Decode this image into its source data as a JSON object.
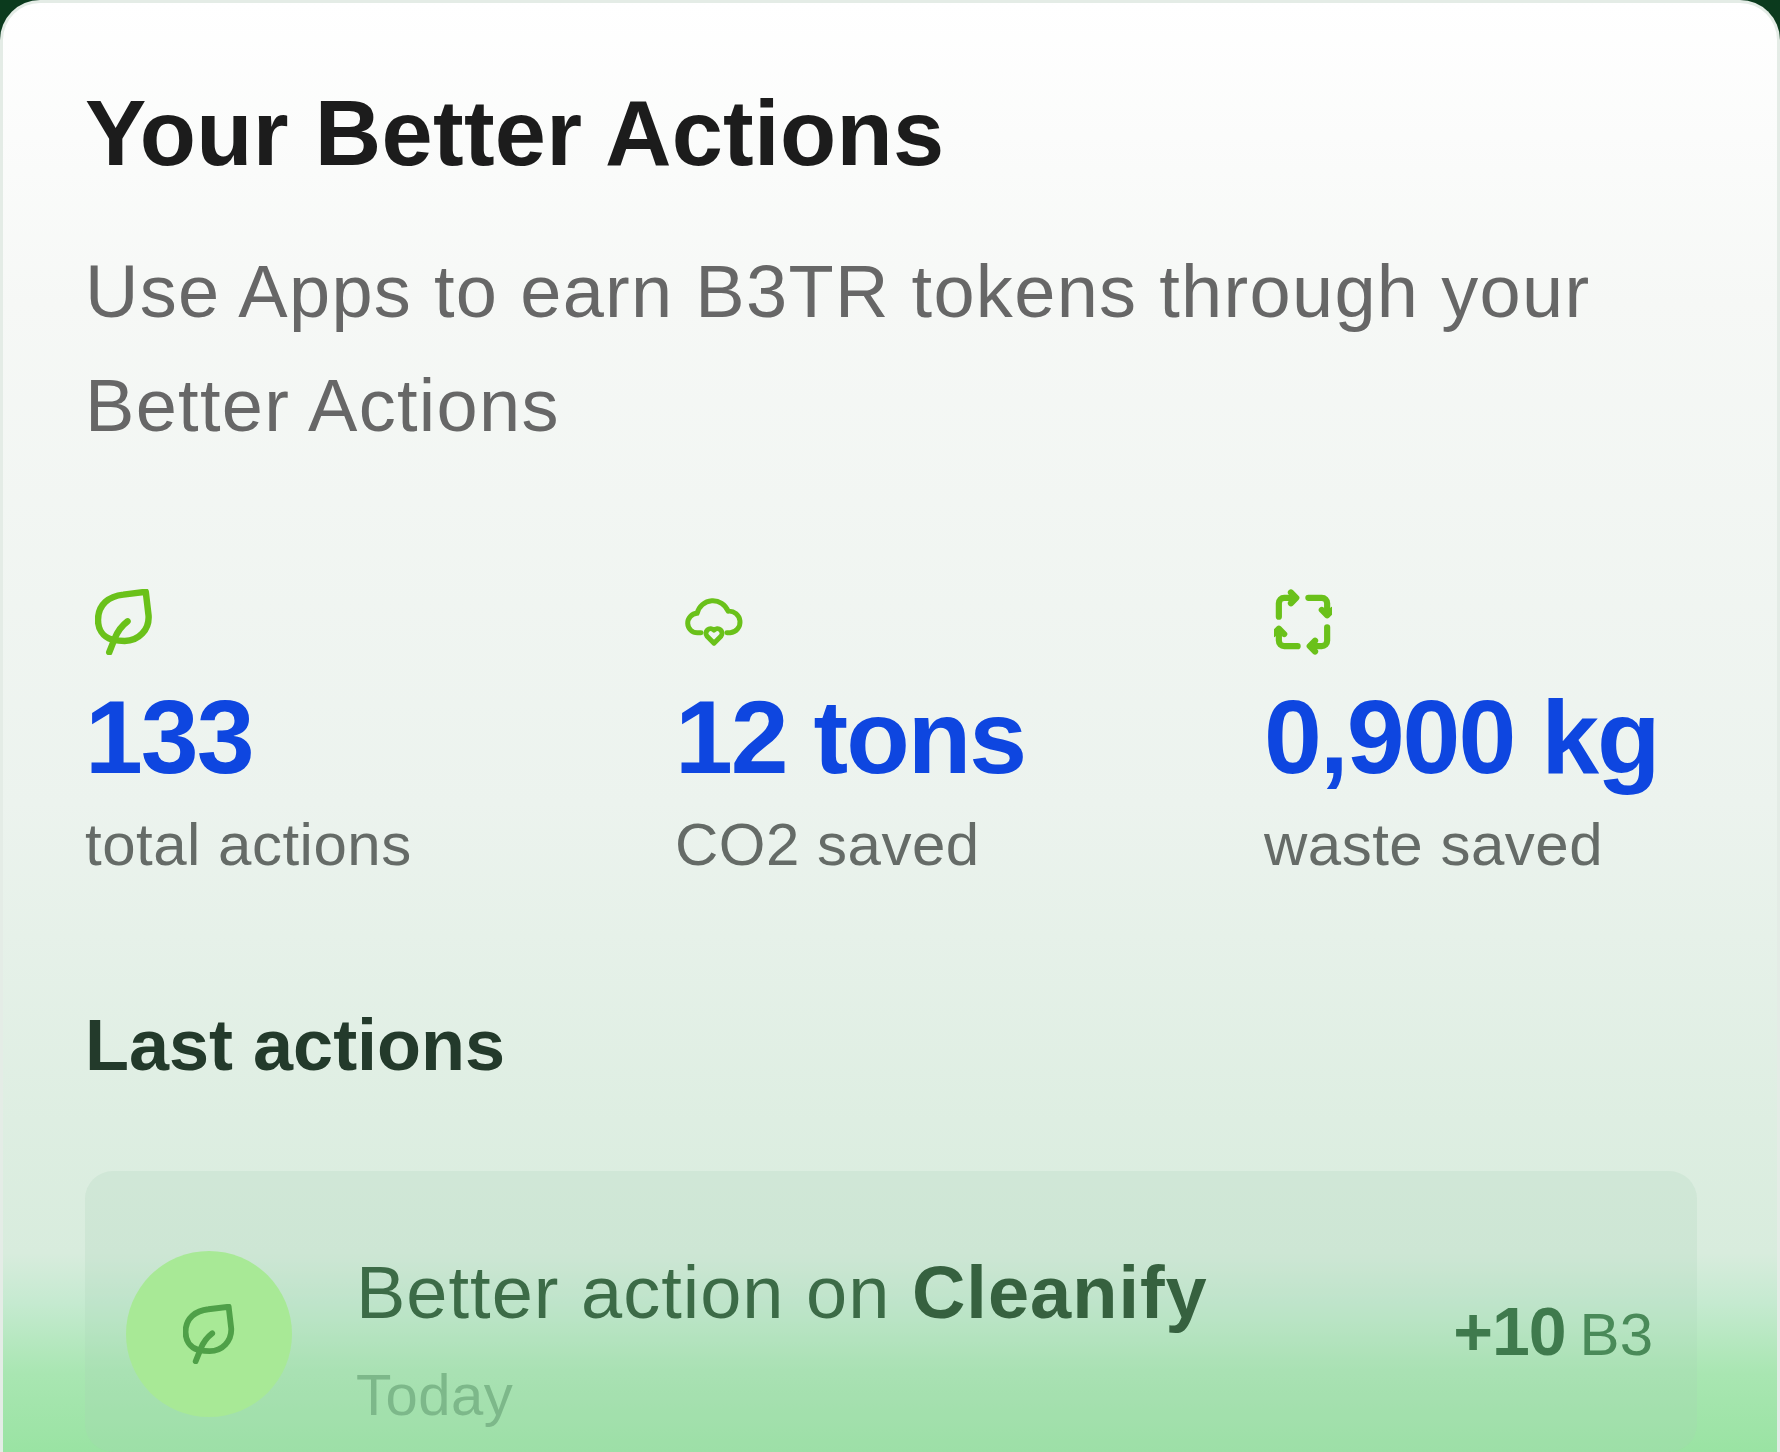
{
  "card": {
    "title": "Your Better Actions",
    "subtitle": "Use Apps to earn B3TR tokens through your Better Actions"
  },
  "stats": [
    {
      "value": "133",
      "label": "total actions"
    },
    {
      "value": "12 tons",
      "label": "CO2 saved"
    },
    {
      "value": "0,900 kg",
      "label": "waste saved"
    }
  ],
  "last_actions": {
    "title": "Last actions",
    "items": [
      {
        "text": "Better action on **Cleanify**",
        "time": "Today",
        "amount": "+10",
        "unit": "B3"
      }
    ]
  }
}
